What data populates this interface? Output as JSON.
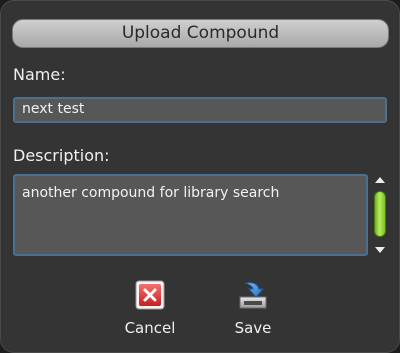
{
  "dialog": {
    "title": "Upload Compound",
    "name": {
      "label": "Name:",
      "value": "next test"
    },
    "description": {
      "label": "Description:",
      "value": "another compound for library search"
    },
    "actions": {
      "cancel_label": "Cancel",
      "save_label": "Save"
    }
  },
  "colors": {
    "background": "#343434",
    "field": "#575757",
    "field_border": "#4d6f8e",
    "scrollbar_thumb": "#8fd13a",
    "cancel_icon": "#e23c3c"
  },
  "icons": {
    "cancel": "close-icon",
    "save": "save-icon"
  }
}
